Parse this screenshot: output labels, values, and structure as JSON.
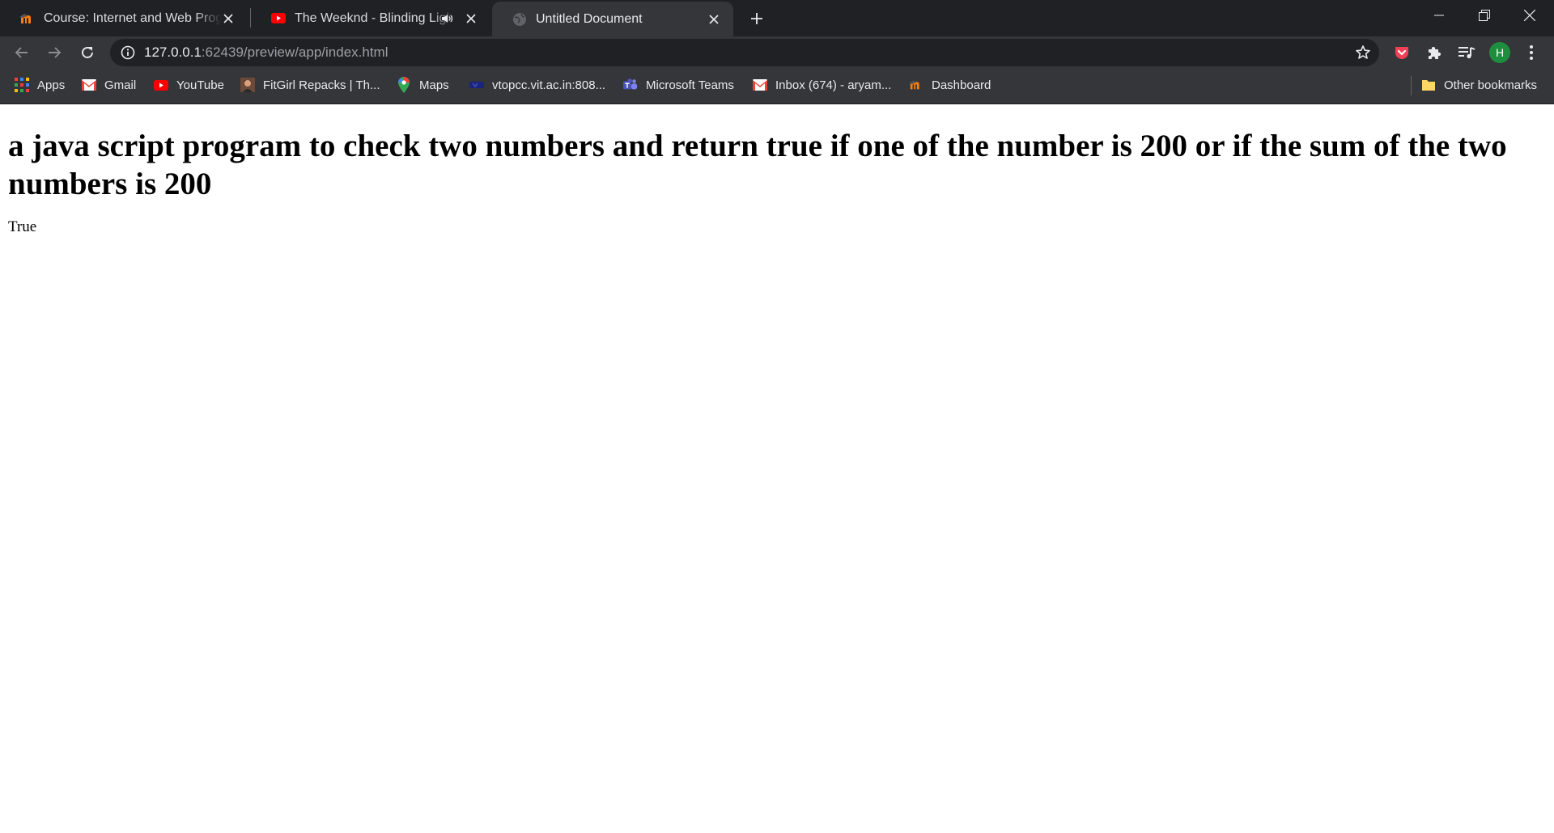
{
  "browser": {
    "tabs": [
      {
        "title": "Course: Internet and Web Progra",
        "favicon": "moodle-icon",
        "active": false
      },
      {
        "title": "The Weeknd - Blinding Light",
        "favicon": "youtube-icon",
        "audio": true,
        "active": false
      },
      {
        "title": "Untitled Document",
        "favicon": "globe-icon",
        "active": true
      }
    ],
    "address": {
      "host": "127.0.0.1",
      "rest": ":62439/preview/app/index.html"
    },
    "profile_initial": "H",
    "bookmarks": [
      {
        "label": "Apps",
        "icon": "apps-grid-icon"
      },
      {
        "label": "Gmail",
        "icon": "gmail-icon"
      },
      {
        "label": "YouTube",
        "icon": "youtube-icon"
      },
      {
        "label": "FitGirl Repacks | Th...",
        "icon": "fitgirl-icon"
      },
      {
        "label": "Maps",
        "icon": "maps-icon"
      },
      {
        "label": "vtopcc.vit.ac.in:808...",
        "icon": "vit-icon"
      },
      {
        "label": "Microsoft Teams",
        "icon": "teams-icon"
      },
      {
        "label": "Inbox (674) - aryam...",
        "icon": "gmail-icon"
      },
      {
        "label": "Dashboard",
        "icon": "moodle-icon"
      }
    ],
    "other_bookmarks": "Other bookmarks",
    "colors": {
      "tabstrip": "#202124",
      "toolbar": "#35363a",
      "omnibox": "#202124",
      "avatar": "#1e8e3e"
    }
  },
  "page": {
    "heading": "a java script program to check two numbers and return true if one of the number is 200 or if the sum of the two numbers is 200",
    "result": "True"
  }
}
